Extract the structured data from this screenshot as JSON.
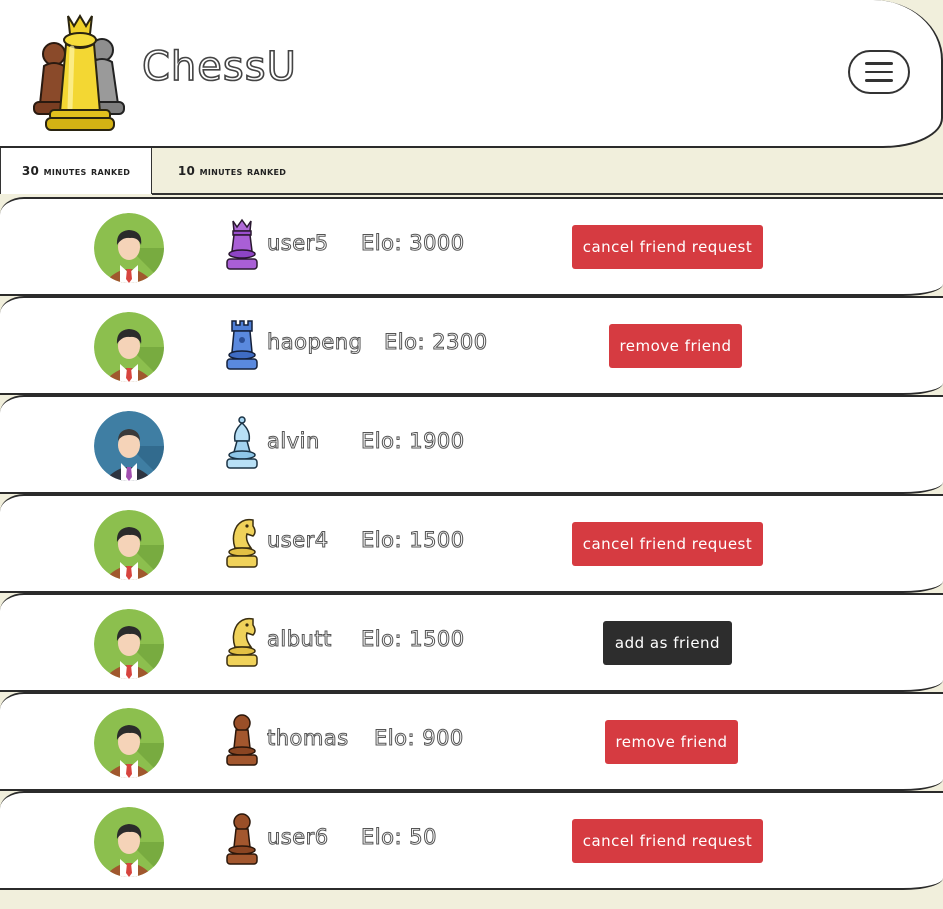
{
  "app": {
    "title": "ChessU"
  },
  "header": {
    "menu_icon": "hamburger-menu-icon"
  },
  "tabs": [
    {
      "label": "30 minutes ranked",
      "active": true
    },
    {
      "label": "10 minutes ranked",
      "active": false
    }
  ],
  "players": [
    {
      "username": "user5",
      "elo": "Elo: 3000",
      "piece": "king-purple",
      "avatar": "green",
      "action": "cancel friend request",
      "action_style": "red"
    },
    {
      "username": "haopeng",
      "elo": "Elo: 2300",
      "piece": "rook-blue",
      "avatar": "green",
      "action": "remove friend",
      "action_style": "red"
    },
    {
      "username": "alvin",
      "elo": "Elo: 1900",
      "piece": "bishop-lightblue",
      "avatar": "blue",
      "action": "",
      "action_style": "none"
    },
    {
      "username": "user4",
      "elo": "Elo: 1500",
      "piece": "knight-gold",
      "avatar": "green",
      "action": "cancel friend request",
      "action_style": "red"
    },
    {
      "username": "albutt",
      "elo": "Elo: 1500",
      "piece": "knight-gold",
      "avatar": "green",
      "action": "add as friend",
      "action_style": "dark"
    },
    {
      "username": "thomas",
      "elo": "Elo: 900",
      "piece": "pawn-brown",
      "avatar": "green",
      "action": "remove friend",
      "action_style": "red"
    },
    {
      "username": "user6",
      "elo": "Elo: 50",
      "piece": "pawn-brown",
      "avatar": "green",
      "action": "cancel friend request",
      "action_style": "red"
    }
  ],
  "colors": {
    "accent_red": "#d63b41",
    "dark_button": "#2d2d2d",
    "background": "#f1efdc"
  }
}
